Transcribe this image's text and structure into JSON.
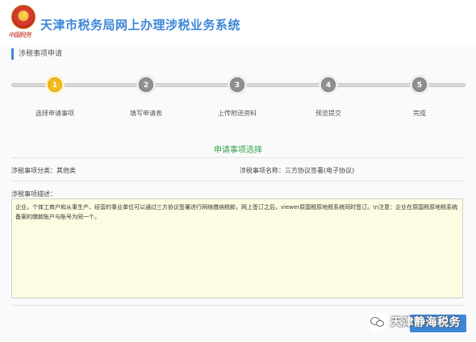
{
  "header": {
    "emblem_text": "中国税务",
    "system_title": "天津市税务局网上办理涉税业务系统"
  },
  "section": {
    "heading": "涉税事项申请"
  },
  "steps": [
    {
      "num": "1",
      "label": "选择申请事项",
      "state": "active"
    },
    {
      "num": "2",
      "label": "填写申请表",
      "state": "todo"
    },
    {
      "num": "3",
      "label": "上传附送资料",
      "state": "todo"
    },
    {
      "num": "4",
      "label": "预览提交",
      "state": "todo"
    },
    {
      "num": "5",
      "label": "完成",
      "state": "todo"
    }
  ],
  "selection": {
    "title": "申请事项选择",
    "category_label": "涉税事项分类：其他类",
    "name_label": "涉税事项名称：三方协议签署(电子协议)",
    "desc_label": "涉税事项描述：",
    "description": "企业，个体工商户和从事生产、经营的事业单位可以通过三方协议签署进行网络缴纳税款，网上签订之后，viewer原国税原地税系统同时签订。\\n注意：企业在原国税原地税系统备案的缴款账户与账号为同一个。"
  },
  "watermark": {
    "text": "天津静海税务"
  },
  "colors": {
    "accent": "#3d86d8",
    "active_step": "#f5b81c",
    "section_title": "#34a34a"
  }
}
